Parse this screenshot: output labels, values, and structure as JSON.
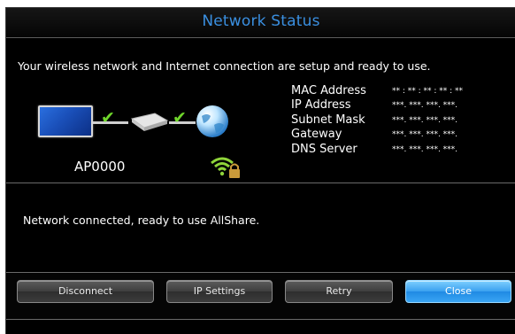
{
  "dialog": {
    "title": "Network Status",
    "message": "Your wireless network and Internet connection are setup and ready to use.",
    "ap_name": "AP0000",
    "status_text": "Network connected, ready to use AllShare."
  },
  "info": {
    "rows": [
      {
        "label": "MAC Address",
        "value": "** : ** : ** : ** : **"
      },
      {
        "label": "IP Address",
        "value": "***.  ***.  ***.  ***."
      },
      {
        "label": "Subnet Mask",
        "value": "***.  ***.  ***.  ***."
      },
      {
        "label": "Gateway",
        "value": "***.  ***.  ***.  ***."
      },
      {
        "label": "DNS Server",
        "value": "***.  ***.  ***.  ***."
      }
    ]
  },
  "buttons": {
    "disconnect": "Disconnect",
    "ip_settings": "IP Settings",
    "retry": "Retry",
    "close": "Close"
  },
  "icons": [
    "tv-icon",
    "check-icon",
    "router-icon",
    "globe-icon",
    "wifi-lock-icon"
  ],
  "colors": {
    "title": "#3a8fe0",
    "check": "#6fd62b",
    "primary_button": "#3aa0ef"
  }
}
